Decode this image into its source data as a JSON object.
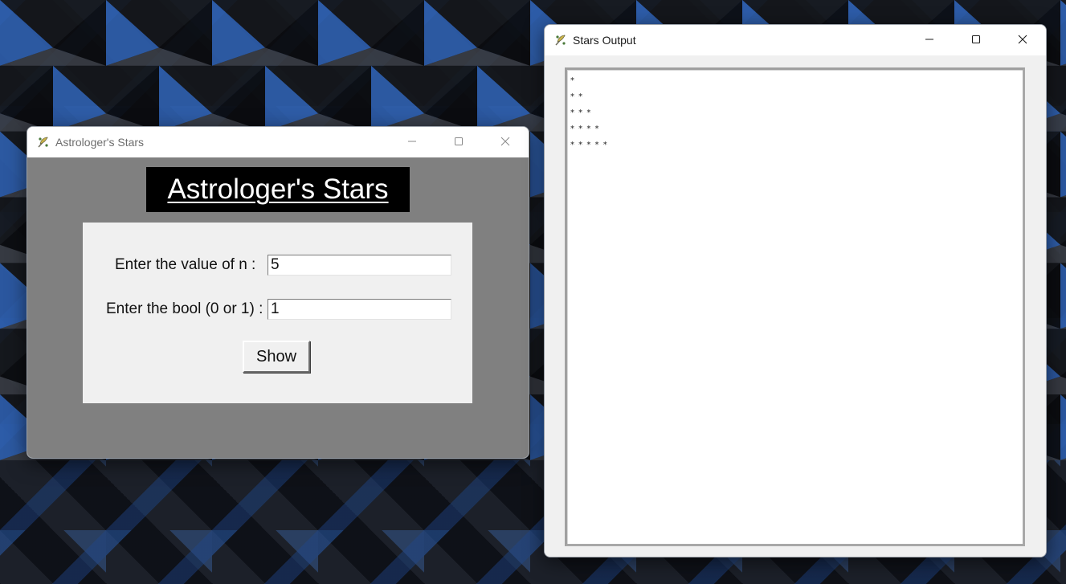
{
  "astro_window": {
    "title": "Astrologer's Stars",
    "icon": "feather-app-icon",
    "heading": "Astrologer's Stars",
    "form": {
      "n_label": "Enter the value of n :",
      "n_value": "5",
      "bool_label": "Enter the bool (0 or 1) :",
      "bool_value": "1",
      "show_label": "Show"
    },
    "caption": {
      "minimize": "minimize-icon",
      "maximize": "maximize-icon",
      "close": "close-icon"
    }
  },
  "stars_window": {
    "title": "Stars Output",
    "icon": "feather-app-icon",
    "lines": [
      "*",
      "* *",
      "* * *",
      "* * * *",
      "* * * * *"
    ],
    "caption": {
      "minimize": "minimize-icon",
      "maximize": "maximize-icon",
      "close": "close-icon"
    }
  },
  "colors": {
    "astro_body_bg": "#808080",
    "heading_bg": "#000000",
    "heading_text": "#ffffff",
    "panel_bg": "#f0f0f0",
    "wallpaper_accent": "#2b5aa8"
  }
}
